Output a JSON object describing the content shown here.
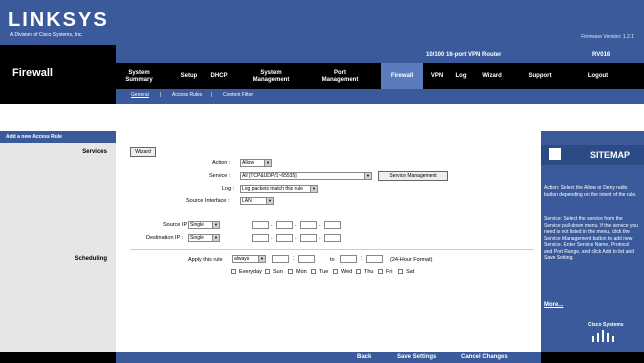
{
  "brand": {
    "logo": "LINKSYS",
    "subtitle": "A Division of Cisco Systems, Inc.",
    "firmware": "Firmware Version: 1.2.1"
  },
  "product": {
    "name": "10/100 16-port VPN Router",
    "model": "RV016"
  },
  "section_title": "Firewall",
  "nav": [
    {
      "label": "System Summary"
    },
    {
      "label": "Setup"
    },
    {
      "label": "DHCP"
    },
    {
      "label": "System Management"
    },
    {
      "label": "Port Management"
    },
    {
      "label": "Firewall"
    },
    {
      "label": "VPN"
    },
    {
      "label": "Log"
    },
    {
      "label": "Wizard"
    },
    {
      "label": "Support"
    },
    {
      "label": "Logout"
    }
  ],
  "subtabs": [
    {
      "label": "General"
    },
    {
      "label": "Access Rules"
    },
    {
      "label": "Content Filter"
    }
  ],
  "left": {
    "header": "Add a new Access Rule",
    "services": "Services",
    "scheduling": "Scheduling"
  },
  "form": {
    "wizard_button": "Wizard",
    "action_label": "Action :",
    "action_value": "Allow",
    "service_label": "Service :",
    "service_value": "All [TCP&UDP/1~65535]",
    "service_mgmt_button": "Service Management",
    "log_label": "Log :",
    "log_value": "Log packets match this rule",
    "source_iface_label": "Source Interface :",
    "source_iface_value": "LAN",
    "source_ip_label": "Source IP :",
    "source_ip_value": "Single",
    "dest_ip_label": "Destination IP :",
    "dest_ip_value": "Single",
    "apply_label": "Apply this rule",
    "apply_value": "always",
    "to_label": "to",
    "format_label": "(24-Hour Format)",
    "days": [
      "Everyday",
      "Sun",
      "Mon",
      "Tue",
      "Wed",
      "Thu",
      "Fri",
      "Sat"
    ]
  },
  "help": {
    "sitemap": "SITEMAP",
    "action_text": "Action: Select the Allow or Deny radio button depending on the intent of the rule.",
    "service_text": "Service: Select the service from the Service pull-down menu. If the service you need is not listed in the menu, click the Service Management button to add new Service. Enter Service Name, Protocol and Port Range, and click Add to list and Save Setting.",
    "more": "More...",
    "cisco": "Cisco Systems"
  },
  "footer": {
    "back": "Back",
    "save": "Save Settings",
    "cancel": "Cancel Changes"
  }
}
